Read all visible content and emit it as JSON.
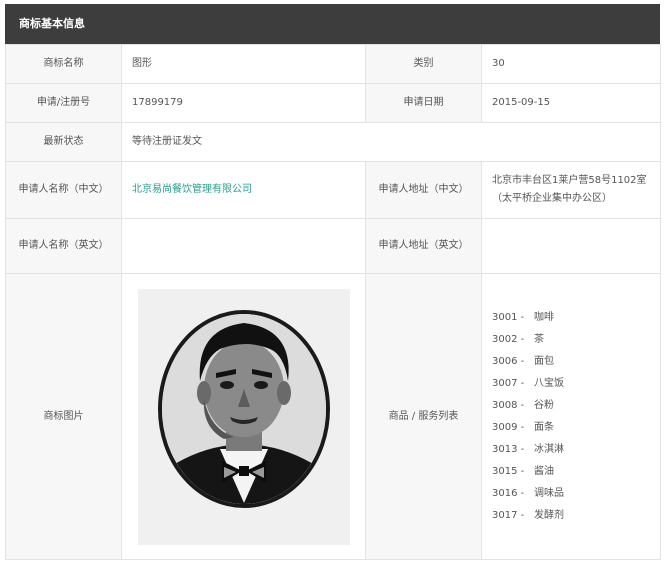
{
  "header": {
    "title": "商标基本信息"
  },
  "rows": {
    "name": {
      "label": "商标名称",
      "value": "图形",
      "label2": "类别",
      "value2": "30"
    },
    "reg": {
      "label": "申请/注册号",
      "value": "17899179",
      "label2": "申请日期",
      "value2": "2015-09-15"
    },
    "status": {
      "label": "最新状态",
      "value": "等待注册证发文"
    },
    "cn": {
      "label": "申请人名称（中文）",
      "value": "北京易尚餐饮管理有限公司",
      "label2": "申请人地址（中文）",
      "value2": "北京市丰台区1莱户营58号1102室（太平桥企业集中办公区）"
    },
    "en": {
      "label": "申请人名称（英文）",
      "value": "",
      "label2": "申请人地址（英文）",
      "value2": ""
    },
    "image": {
      "label": "商标图片",
      "label2": "商品 / 服务列表"
    }
  },
  "goods": [
    {
      "code": "3001 -",
      "name": "咖啡"
    },
    {
      "code": "3002 -",
      "name": "茶"
    },
    {
      "code": "3006 -",
      "name": "面包"
    },
    {
      "code": "3007 -",
      "name": "八宝饭"
    },
    {
      "code": "3008 -",
      "name": "谷粉"
    },
    {
      "code": "3009 -",
      "name": "面条"
    },
    {
      "code": "3013 -",
      "name": "冰淇淋"
    },
    {
      "code": "3015 -",
      "name": "酱油"
    },
    {
      "code": "3016 -",
      "name": "调味品"
    },
    {
      "code": "3017 -",
      "name": "发酵剂"
    }
  ],
  "colors": {
    "header_bg": "#3d3d3d",
    "label_bg": "#f7f7f7",
    "border": "#e3e3e3",
    "link": "#2a9d8f"
  }
}
